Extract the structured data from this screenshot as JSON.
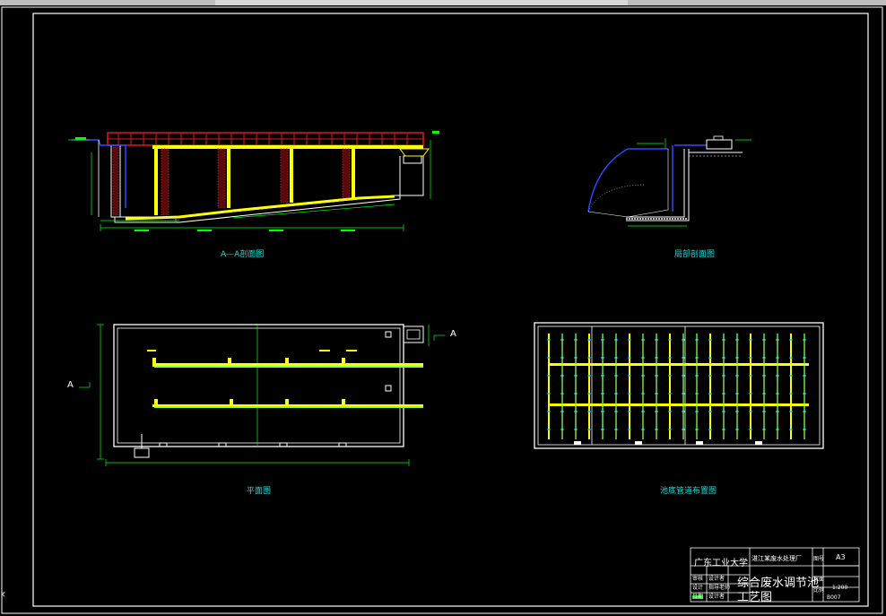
{
  "titles": {
    "section_aa": "A—A剖面图",
    "section_local": "局部剖面图",
    "plan": "平面图",
    "pipe_layout": "池底管道布置图"
  },
  "markers": {
    "a_right": "A",
    "a_left": "A"
  },
  "title_block": {
    "school": "广东工业大学",
    "project": "湛江某废水处理厂",
    "drawing_name_1": "综合废水调节池",
    "drawing_name_2": "工艺图",
    "size_label": "图号",
    "size_value": "A3",
    "scale_label": "比例",
    "scale_value": "1:200",
    "ratio_label": "水面",
    "drawing_no": "B007",
    "row1": "审核",
    "row2": "设计者",
    "row3": "设计",
    "row4": "指导老师",
    "row5": "日期",
    "row6": "设计者"
  },
  "colors": {
    "frame": "#ffffff",
    "red": "#e01818",
    "yellow": "#ffff00",
    "green": "#00ff00",
    "blue": "#2a4cff",
    "white": "#ffffff",
    "cyan": "#22dddd"
  }
}
